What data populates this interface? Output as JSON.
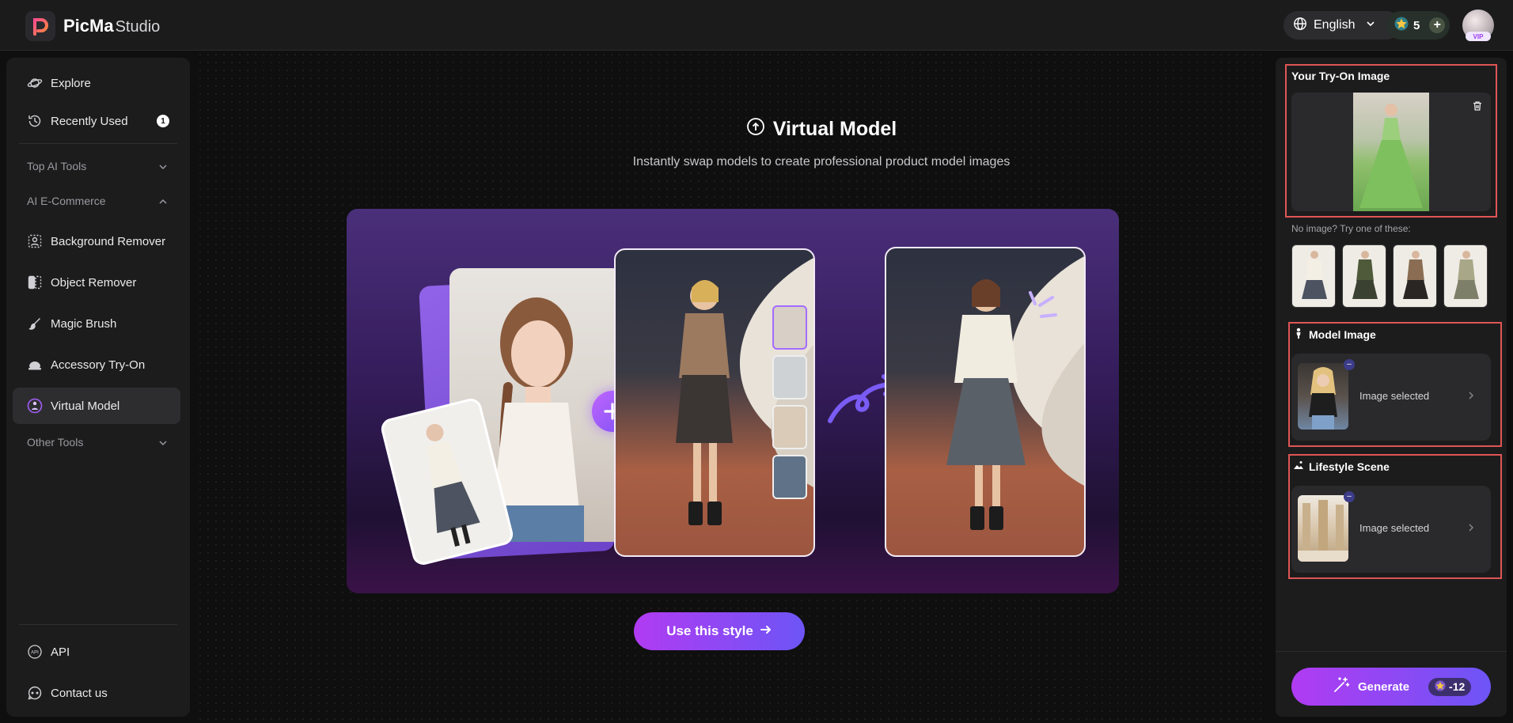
{
  "app": {
    "name": "PicMa",
    "studio": "Studio"
  },
  "header": {
    "language": "English",
    "credits": "5",
    "vip": "VIP"
  },
  "sidebar": {
    "explore": "Explore",
    "recently_used": "Recently Used",
    "recently_used_badge": "1",
    "top_ai_tools": "Top AI Tools",
    "ai_ecommerce": "AI E-Commerce",
    "items": [
      "Background Remover",
      "Object Remover",
      "Magic Brush",
      "Accessory Try-On",
      "Virtual Model"
    ],
    "other_tools": "Other Tools",
    "api": "API",
    "contact": "Contact us"
  },
  "main": {
    "title": "Virtual Model",
    "subtitle": "Instantly swap models to create professional product model images",
    "cta": "Use this style"
  },
  "panel": {
    "tryon_title": "Your Try-On Image",
    "hint": "No image? Try one of these:",
    "model_title": "Model Image",
    "model_status": "Image selected",
    "scene_title": "Lifestyle Scene",
    "scene_status": "Image selected",
    "generate": "Generate",
    "generate_cost": "-12"
  },
  "colors": {
    "accent_start": "#b13bf2",
    "accent_end": "#6d55f6",
    "highlight": "#e05555"
  }
}
